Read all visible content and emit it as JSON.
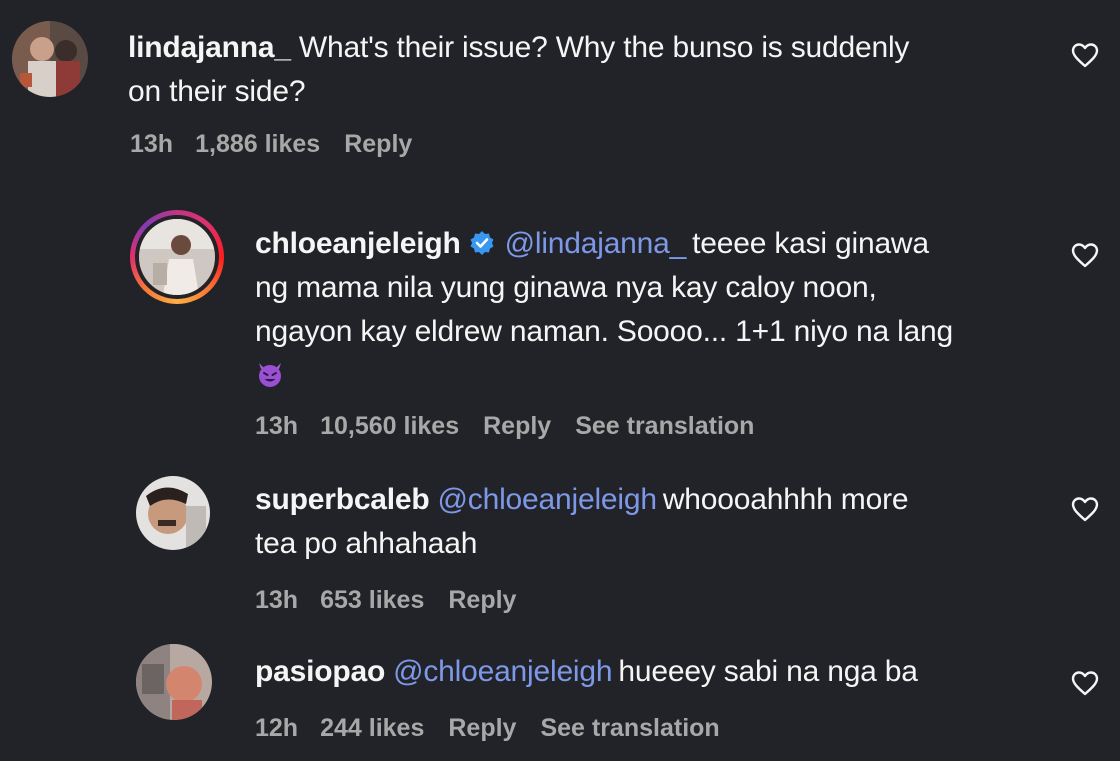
{
  "comments": [
    {
      "username": "lindajanna_",
      "text": "What's their issue? Why the bunso is suddenly on their side?",
      "text_line1": "What's their issue? Why the bunso is suddenly",
      "text_line2": "on their side?",
      "time": "13h",
      "likes": "1,886 likes",
      "reply": "Reply"
    },
    {
      "username": "chloeanjeleigh",
      "verified": true,
      "mention": "@lindajanna_",
      "text_line1": "teeee kasi ginawa",
      "text_line2": "ng mama nila yung ginawa nya kay caloy noon,",
      "text_line3": "ngayon kay eldrew naman. Soooo... 1+1 niyo na lang",
      "emoji": "smiling-face-with-horns",
      "time": "13h",
      "likes": "10,560 likes",
      "reply": "Reply",
      "see_translation": "See translation"
    },
    {
      "username": "superbcaleb",
      "mention": "@chloeanjeleigh",
      "text_line1": "whoooahhhh more",
      "text_line2": "tea po ahhahaah",
      "time": "13h",
      "likes": "653 likes",
      "reply": "Reply"
    },
    {
      "username": "pasiopao",
      "mention": "@chloeanjeleigh",
      "text_line1": "hueeey sabi na nga ba",
      "time": "12h",
      "likes": "244 likes",
      "reply": "Reply",
      "see_translation": "See translation"
    }
  ],
  "colors": {
    "background": "#212328",
    "text": "#f5f5f5",
    "meta": "#a8a8a8",
    "mention": "#7e98e8",
    "verified": "#3897f0"
  },
  "icons": {
    "like": "heart-outline-icon",
    "verified": "verified-badge-icon"
  }
}
